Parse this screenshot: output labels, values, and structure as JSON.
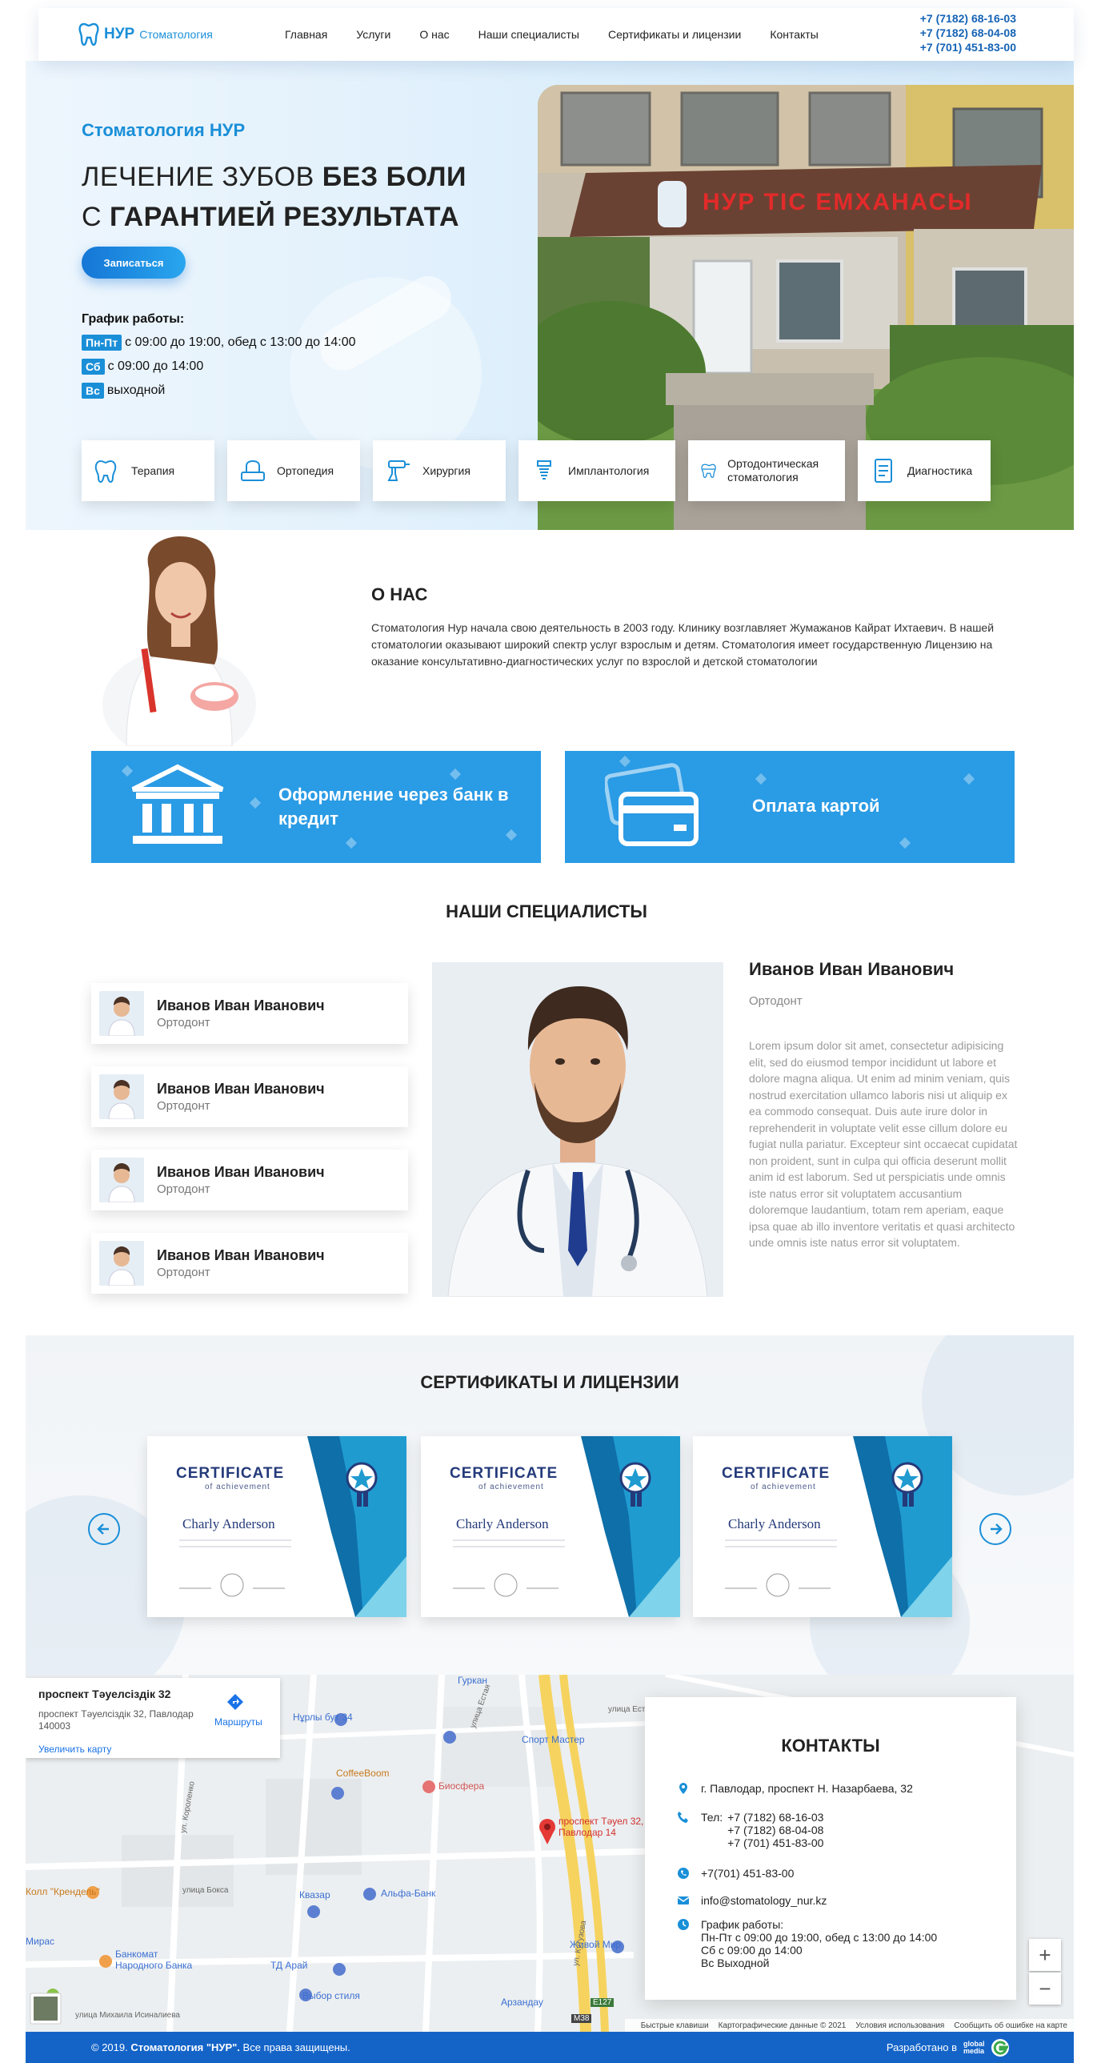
{
  "header": {
    "logo_main": "НУР",
    "logo_sub": "Стоматология",
    "nav": [
      "Главная",
      "Услуги",
      "О нас",
      "Наши специалисты",
      "Сертификаты и лицензии",
      "Контакты"
    ],
    "phones": [
      "+7 (7182) 68-16-03",
      "+7 (7182) 68-04-08",
      "+7 (701) 451-83-00"
    ]
  },
  "hero": {
    "subtitle": "Стоматология НУР",
    "title_line1_light": "ЛЕЧЕНИЕ ЗУБОВ ",
    "title_line1_bold": "БЕЗ БОЛИ",
    "title_line2_light": "С ",
    "title_line2_bold": "ГАРАНТИЕЙ РЕЗУЛЬТАТА",
    "book_button": "Записаться",
    "schedule_title": "График работы:",
    "schedule": [
      {
        "badge": "Пн-Пт",
        "text": "с 09:00 до 19:00, обед с 13:00 до 14:00"
      },
      {
        "badge": "Сб",
        "text": "с 09:00 до 14:00"
      },
      {
        "badge": "Вс",
        "text": "выходной"
      }
    ],
    "sign_text": "НУР ТІС ЕМХАНАСЫ"
  },
  "services": [
    {
      "label": "Терапия",
      "icon": "tooth-therapy-icon"
    },
    {
      "label": "Ортопедия",
      "icon": "tooth-crown-icon"
    },
    {
      "label": "Хирургия",
      "icon": "dental-drill-icon"
    },
    {
      "label": "Имплантология",
      "icon": "implant-icon"
    },
    {
      "label": "Ортодонтическая стоматология",
      "icon": "braces-icon"
    },
    {
      "label": "Диагностика",
      "icon": "diagnostics-icon"
    }
  ],
  "about": {
    "title": "О НАС",
    "text": "Стоматология Нур начала свою деятельность в 2003 году. Клинику возглавляет Жумажанов Кайрат Ихтаевич. В нашей стоматологии оказывают широкий спектр услуг взрослым и детям. Стоматология имеет государственную Лицензию на оказание консультативно-диагностических услуг по взрослой и детской стоматологии"
  },
  "banners": {
    "credit": "Оформление через банк в кредит",
    "card": "Оплата картой"
  },
  "specialists": {
    "title": "НАШИ СПЕЦИАЛИСТЫ",
    "list": [
      {
        "name": "Иванов Иван Иванович",
        "role": "Ортодонт"
      },
      {
        "name": "Иванов Иван Иванович",
        "role": "Ортодонт"
      },
      {
        "name": "Иванов Иван Иванович",
        "role": "Ортодонт"
      },
      {
        "name": "Иванов Иван Иванович",
        "role": "Ортодонт"
      }
    ],
    "selected": {
      "name": "Иванов Иван Иванович",
      "role": "Ортодонт",
      "bio": "Lorem ipsum dolor sit amet, consectetur adipisicing elit, sed do eiusmod tempor incididunt ut labore et dolore magna aliqua. Ut enim ad minim veniam, quis nostrud exercitation ullamco laboris nisi ut aliquip ex ea commodo consequat. Duis aute irure dolor in reprehenderit in voluptate velit esse cillum dolore eu fugiat nulla pariatur. Excepteur sint occaecat cupidatat non proident, sunt in culpa qui officia deserunt mollit anim id est laborum. Sed ut perspiciatis unde omnis iste natus error sit voluptatem accusantium doloremque laudantium, totam rem aperiam, eaque ipsa quae ab illo inventore veritatis et quasi architecto unde omnis iste natus error sit voluptatem."
    }
  },
  "certificates": {
    "title": "СЕРТИФИКАТЫ И ЛИЦЕНЗИИ",
    "items": [
      {
        "heading": "CERTIFICATE",
        "sub": "of achievement",
        "name": "Charly Anderson"
      },
      {
        "heading": "CERTIFICATE",
        "sub": "of achievement",
        "name": "Charly Anderson"
      },
      {
        "heading": "CERTIFICATE",
        "sub": "of achievement",
        "name": "Charly Anderson"
      }
    ]
  },
  "map": {
    "card_title": "проспект Тәуелсіздік 32",
    "card_address": "проспект Тәуелсіздік 32, Павлодар 140003",
    "card_routes": "Маршруты",
    "card_zoom": "Увеличить карту",
    "places": [
      "Спорт Мастер",
      "CoffeeBoom",
      "Биосфера",
      "Альфа-Банк",
      "Квазар",
      "Живой Мир",
      "ТД Арай",
      "Выбор стиля",
      "Банкомат Народного Банка",
      "Колл \"Крендель\"",
      "Мирас",
      "Арзандау",
      "Нұрлы бут 34",
      "Гуркан",
      "проспект Тәуел 32, Павлодар 14"
    ],
    "streets": [
      "улица Естая",
      "улица Естая",
      "улица Бокса",
      "ул. Короленко",
      "улица Михаила Исиналиева",
      "ул. Кутузова",
      "М38",
      "E127"
    ],
    "footer": [
      "Быстрые клавиши",
      "Картографические данные © 2021",
      "Условия использования",
      "Сообщить об ошибке на карте"
    ],
    "zoom_in": "+",
    "zoom_out": "−"
  },
  "contacts": {
    "title": "КОНТАКТЫ",
    "address": "г. Павлодар, проспект Н. Назарбаева, 32",
    "tel_label": "Тел:",
    "phones": [
      "+7 (7182) 68-16-03",
      "+7 (7182) 68-04-08",
      "+7 (701) 451-83-00"
    ],
    "whatsapp": "+7(701) 451-83-00",
    "email": "info@stomatology_nur.kz",
    "hours_title": "График работы:",
    "hours": [
      "Пн-Пт с 09:00 до 19:00, обед с 13:00 до 14:00",
      "Сб с 09:00 до 14:00",
      "Вс Выходной"
    ]
  },
  "footer": {
    "copyright_prefix": "© 2019.",
    "copyright_brand": "Стоматология \"НУР\".",
    "copyright_suffix": "Все права защищены.",
    "dev_label": "Разработано в",
    "dev_brand": "global media"
  },
  "colors": {
    "accent": "#1a8fd8",
    "banner": "#2a9be5",
    "footer": "#1464c8"
  }
}
